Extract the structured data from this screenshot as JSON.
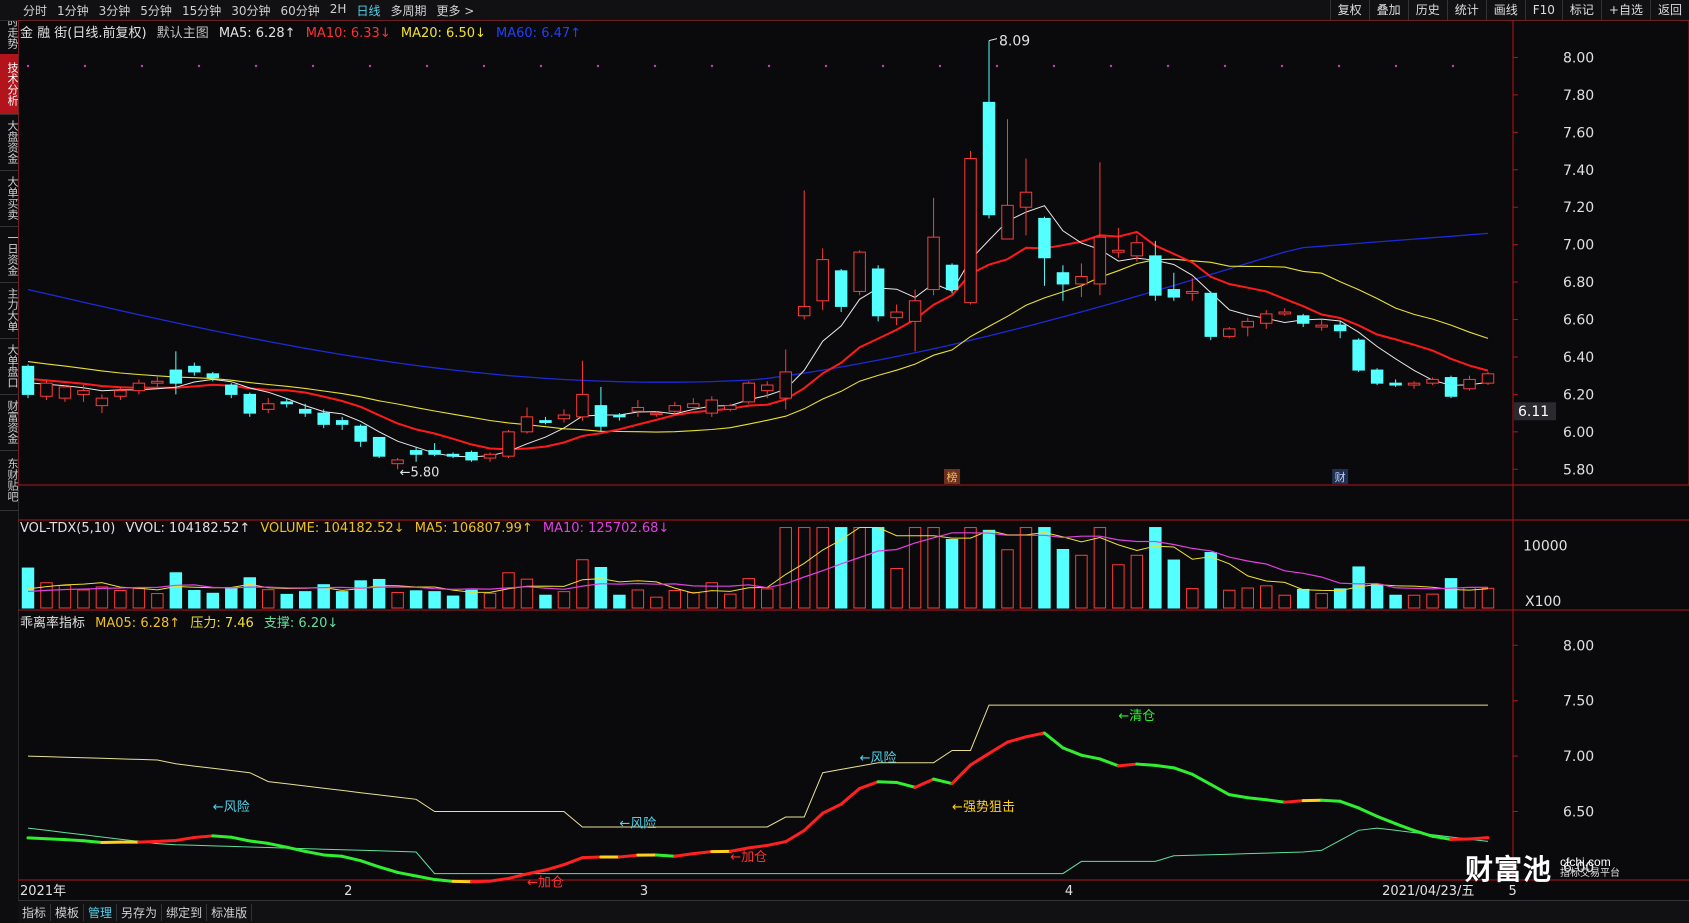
{
  "toolbar": {
    "timeframes": [
      "分时",
      "1分钟",
      "3分钟",
      "5分钟",
      "15分钟",
      "30分钟",
      "60分钟",
      "2H",
      "日线",
      "多周期",
      "更多 >"
    ],
    "active": "日线",
    "right_buttons": [
      "复权",
      "叠加",
      "历史",
      "统计",
      "画线",
      "F10",
      "标记",
      "+自选",
      "返回"
    ]
  },
  "sidebar": {
    "tabs": [
      "分时走势",
      "技术分析",
      "大盘资金",
      "大单买卖",
      "一日资金",
      "主力大单",
      "大单盘口",
      "财富资金",
      "东财贴吧"
    ],
    "active": "技术分析"
  },
  "main_header": {
    "stock": "金 融 街(日线.前复权)",
    "template": "默认主图",
    "ma5": "MA5: 6.28↑",
    "ma10": "MA10: 6.33↓",
    "ma20": "MA20: 6.50↓",
    "ma60": "MA60: 6.47↑"
  },
  "vol_header": {
    "name": "VOL-TDX(5,10)",
    "vvol": "VVOL: 104182.52↑",
    "volume": "VOLUME: 104182.52↓",
    "ma5": "MA5: 106807.99↑",
    "ma10": "MA10: 125702.68↓"
  },
  "ind_header": {
    "name": "乖离率指标",
    "ma05": "MA05: 6.28↑",
    "pressure": "压力: 7.46",
    "support": "支撑: 6.20↓"
  },
  "price_axis": [
    "8.00",
    "7.80",
    "7.60",
    "7.40",
    "7.20",
    "7.00",
    "6.80",
    "6.60",
    "6.40",
    "6.20",
    "6.00",
    "5.80"
  ],
  "current_price": "6.11",
  "vol_axis": [
    "10000",
    "X100"
  ],
  "ind_axis": [
    "8.00",
    "7.50",
    "7.00",
    "6.50",
    "6.00"
  ],
  "x_labels": [
    "2021年",
    "2",
    "3",
    "4",
    "2021/04/23/五",
    "5"
  ],
  "annotations": {
    "high": "8.09",
    "low": "5.80",
    "bang": "榜",
    "cai": "财",
    "risk": "←风险",
    "add": "←加仓",
    "strong": "←强势狙击",
    "clear": "←清仓"
  },
  "bottom_tabs": [
    "指标",
    "模板",
    "管理",
    "另存为",
    "绑定到",
    "标准版"
  ],
  "bottom_active": "管理",
  "watermark": {
    "brand": "财富池",
    "url": "cfchi.com",
    "sub": "指标交易平台"
  },
  "chart_data": [
    {
      "type": "candlestick",
      "title": "金 融 街(日线.前复权)",
      "ylim": [
        5.7,
        8.2
      ],
      "candles": [
        [
          6.35,
          6.2,
          6.36,
          6.18
        ],
        [
          6.19,
          6.26,
          6.28,
          6.17
        ],
        [
          6.18,
          6.24,
          6.25,
          6.16
        ],
        [
          6.2,
          6.22,
          6.25,
          6.16
        ],
        [
          6.14,
          6.18,
          6.2,
          6.1
        ],
        [
          6.19,
          6.22,
          6.24,
          6.17
        ],
        [
          6.22,
          6.26,
          6.28,
          6.2
        ],
        [
          6.26,
          6.27,
          6.3,
          6.24
        ],
        [
          6.33,
          6.26,
          6.43,
          6.2
        ],
        [
          6.35,
          6.32,
          6.37,
          6.3
        ],
        [
          6.31,
          6.29,
          6.32,
          6.27
        ],
        [
          6.25,
          6.2,
          6.26,
          6.18
        ],
        [
          6.2,
          6.1,
          6.21,
          6.08
        ],
        [
          6.12,
          6.15,
          6.18,
          6.1
        ],
        [
          6.16,
          6.15,
          6.18,
          6.13
        ],
        [
          6.12,
          6.1,
          6.15,
          6.08
        ],
        [
          6.1,
          6.04,
          6.12,
          6.02
        ],
        [
          6.06,
          6.04,
          6.08,
          6.01
        ],
        [
          6.03,
          5.95,
          6.04,
          5.92
        ],
        [
          5.97,
          5.87,
          5.97,
          5.86
        ],
        [
          5.83,
          5.85,
          5.86,
          5.8
        ],
        [
          5.9,
          5.88,
          5.92,
          5.84
        ],
        [
          5.9,
          5.88,
          5.94,
          5.87
        ],
        [
          5.88,
          5.87,
          5.89,
          5.86
        ],
        [
          5.89,
          5.85,
          5.9,
          5.84
        ],
        [
          5.86,
          5.88,
          5.89,
          5.84
        ],
        [
          5.87,
          6.0,
          6.01,
          5.86
        ],
        [
          6.0,
          6.08,
          6.13,
          5.99
        ],
        [
          6.06,
          6.05,
          6.08,
          6.04
        ],
        [
          6.07,
          6.09,
          6.12,
          6.05
        ],
        [
          6.08,
          6.2,
          6.38,
          6.06
        ],
        [
          6.14,
          6.03,
          6.24,
          6.0
        ],
        [
          6.09,
          6.08,
          6.1,
          6.06
        ],
        [
          6.11,
          6.13,
          6.17,
          6.08
        ],
        [
          6.1,
          6.1,
          6.11,
          6.08
        ],
        [
          6.11,
          6.14,
          6.16,
          6.09
        ],
        [
          6.13,
          6.15,
          6.18,
          6.12
        ],
        [
          6.1,
          6.17,
          6.19,
          6.08
        ],
        [
          6.12,
          6.14,
          6.15,
          6.11
        ],
        [
          6.16,
          6.26,
          6.27,
          6.15
        ],
        [
          6.22,
          6.25,
          6.27,
          6.18
        ],
        [
          6.18,
          6.32,
          6.44,
          6.12
        ],
        [
          6.62,
          6.67,
          7.29,
          6.6
        ],
        [
          6.7,
          6.92,
          6.98,
          6.65
        ],
        [
          6.86,
          6.67,
          6.87,
          6.64
        ],
        [
          6.75,
          6.96,
          6.97,
          6.73
        ],
        [
          6.87,
          6.62,
          6.89,
          6.59
        ],
        [
          6.61,
          6.64,
          6.68,
          6.57
        ],
        [
          6.59,
          6.7,
          6.76,
          6.43
        ],
        [
          6.76,
          7.04,
          7.25,
          6.73
        ],
        [
          6.89,
          6.76,
          6.9,
          6.74
        ],
        [
          6.69,
          7.46,
          7.5,
          6.68
        ],
        [
          7.76,
          7.16,
          8.09,
          7.14
        ],
        [
          7.03,
          7.21,
          7.67,
          7.03
        ],
        [
          7.2,
          7.28,
          7.46,
          7.05
        ],
        [
          7.14,
          6.93,
          7.15,
          6.78
        ],
        [
          6.85,
          6.79,
          6.89,
          6.7
        ],
        [
          6.79,
          6.83,
          6.9,
          6.72
        ],
        [
          6.79,
          7.04,
          7.44,
          6.73
        ],
        [
          6.96,
          6.97,
          7.09,
          6.93
        ],
        [
          6.94,
          7.01,
          7.05,
          6.91
        ],
        [
          6.94,
          6.73,
          7.02,
          6.7
        ],
        [
          6.76,
          6.72,
          6.85,
          6.7
        ],
        [
          6.74,
          6.75,
          6.82,
          6.7
        ],
        [
          6.74,
          6.51,
          6.75,
          6.49
        ],
        [
          6.51,
          6.55,
          6.56,
          6.5
        ],
        [
          6.56,
          6.59,
          6.61,
          6.51
        ],
        [
          6.58,
          6.63,
          6.65,
          6.55
        ],
        [
          6.63,
          6.64,
          6.66,
          6.62
        ],
        [
          6.62,
          6.58,
          6.63,
          6.56
        ],
        [
          6.56,
          6.57,
          6.6,
          6.54
        ],
        [
          6.57,
          6.54,
          6.59,
          6.5
        ],
        [
          6.49,
          6.33,
          6.5,
          6.32
        ],
        [
          6.33,
          6.26,
          6.34,
          6.25
        ],
        [
          6.26,
          6.25,
          6.28,
          6.24
        ],
        [
          6.25,
          6.26,
          6.27,
          6.23
        ],
        [
          6.26,
          6.28,
          6.29,
          6.25
        ],
        [
          6.29,
          6.19,
          6.3,
          6.18
        ],
        [
          6.23,
          6.28,
          6.3,
          6.22
        ],
        [
          6.26,
          6.31,
          6.32,
          6.25
        ]
      ]
    },
    {
      "type": "bar",
      "title": "VOL-TDX(5,10)"
    },
    {
      "type": "line",
      "title": "乖离率指标",
      "ylim": [
        5.9,
        8.3
      ]
    }
  ]
}
